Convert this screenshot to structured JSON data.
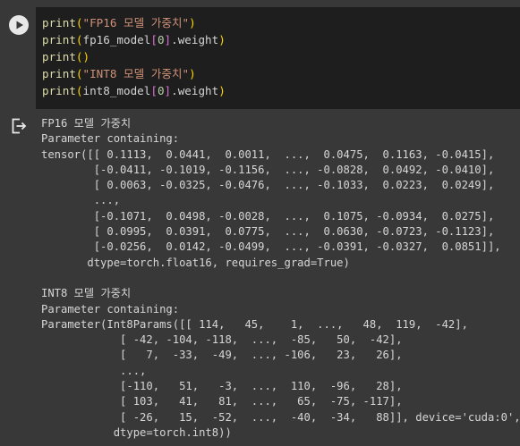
{
  "code_cell": {
    "lines": [
      {
        "fn": "print",
        "open": "(",
        "str": "\"FP16 모델 가중치\"",
        "close": ")"
      },
      {
        "fn": "print",
        "open": "(",
        "arg": "fp16_model",
        "idx_open": "[",
        "idx": "0",
        "idx_close": "]",
        "attr": ".weight",
        "close": ")"
      },
      {
        "fn": "print",
        "open": "(",
        "close": ")"
      },
      {
        "fn": "print",
        "open": "(",
        "str": "\"INT8 모델 가중치\"",
        "close": ")"
      },
      {
        "fn": "print",
        "open": "(",
        "arg": "int8_model",
        "idx_open": "[",
        "idx": "0",
        "idx_close": "]",
        "attr": ".weight",
        "close": ")"
      }
    ]
  },
  "output": {
    "fp16_block": [
      "FP16 모델 가중치",
      "Parameter containing:",
      "tensor([[ 0.1113,  0.0441,  0.0011,  ...,  0.0475,  0.1163, -0.0415],",
      "        [-0.0411, -0.1019, -0.1156,  ..., -0.0828,  0.0492, -0.0410],",
      "        [ 0.0063, -0.0325, -0.0476,  ..., -0.1033,  0.0223,  0.0249],",
      "        ...,",
      "        [-0.1071,  0.0498, -0.0028,  ...,  0.1075, -0.0934,  0.0275],",
      "        [ 0.0995,  0.0391,  0.0775,  ...,  0.0630, -0.0723, -0.1123],",
      "        [-0.0256,  0.0142, -0.0499,  ..., -0.0391, -0.0327,  0.0851]],",
      "       dtype=torch.float16, requires_grad=True)"
    ],
    "int8_block": [
      "INT8 모델 가중치",
      "Parameter containing:",
      "Parameter(Int8Params([[ 114,   45,    1,  ...,   48,  119,  -42],",
      "            [ -42, -104, -118,  ...,  -85,   50,  -42],",
      "            [   7,  -33,  -49,  ..., -106,   23,   26],",
      "            ...,",
      "            [-110,   51,   -3,  ...,  110,  -96,   28],",
      "            [ 103,   41,   81,  ...,   65,  -75, -117],",
      "            [ -26,   15,  -52,  ...,  -40,  -34,   88]], device='cuda:0',",
      "           dtype=torch.int8))"
    ]
  },
  "icons": {
    "run": "play-icon",
    "output": "output-arrow-icon"
  },
  "colors": {
    "background": "#383838",
    "editor": "#1e1e1e",
    "function": "#dcdcaa",
    "string": "#ce9178",
    "number": "#b5cea8",
    "bracket": "#ffd700",
    "bracket_nested": "#da70d6",
    "output_text": "#d6d6d6"
  }
}
